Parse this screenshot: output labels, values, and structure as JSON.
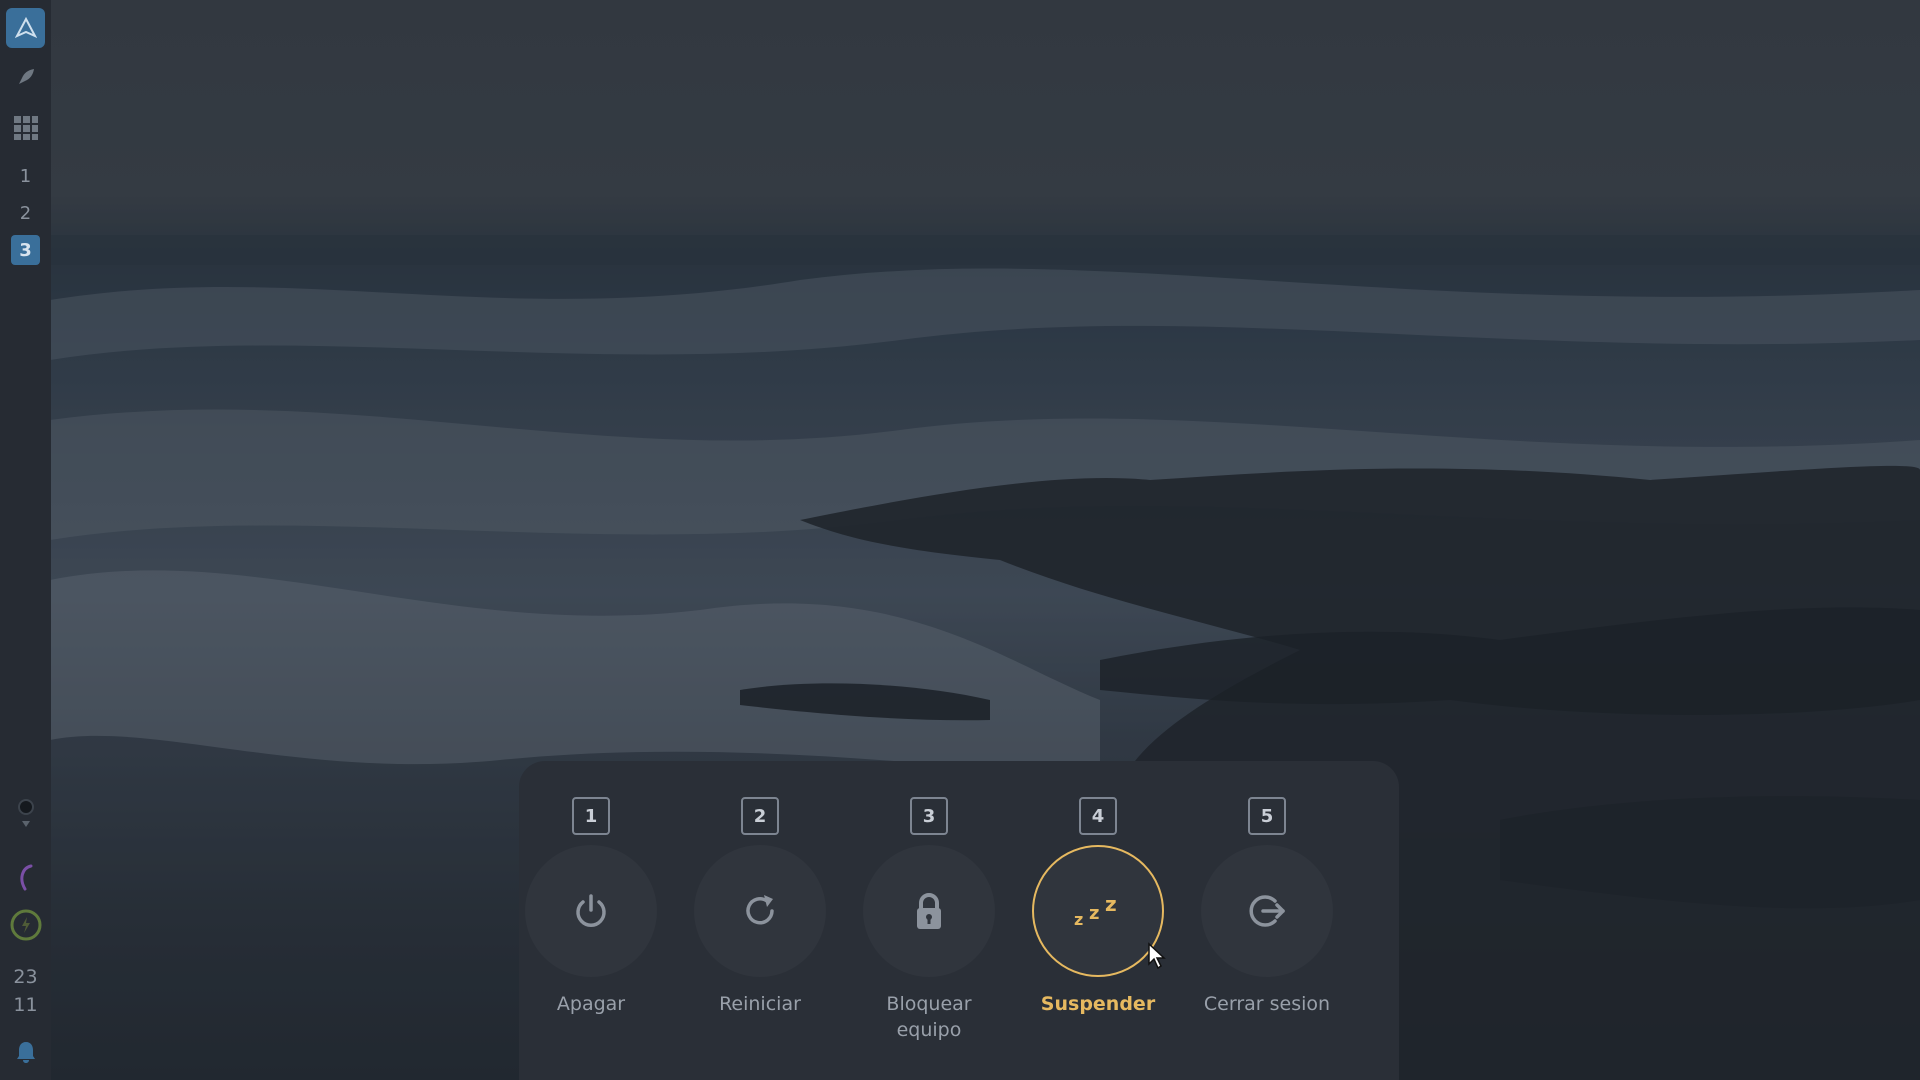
{
  "sidebar": {
    "logo_icon": "arch-logo-icon",
    "launcher_icon": "rocket-icon",
    "apps_icon": "grid-icon",
    "workspaces": [
      "1",
      "2",
      "3"
    ],
    "active_workspace": "3",
    "tray_icons": [
      "bluetooth-icon",
      "wifi-icon",
      "night-light-icon",
      "power-profile-icon"
    ],
    "clock": {
      "hours": "23",
      "minutes": "11"
    },
    "notification_icon": "bell-icon"
  },
  "power_menu": {
    "accent_color": "#e6b960",
    "selected": "Suspender",
    "options": [
      {
        "key": "1",
        "label": "Apagar",
        "icon": "power-icon"
      },
      {
        "key": "2",
        "label": "Reiniciar",
        "icon": "restart-icon"
      },
      {
        "key": "3",
        "label": "Bloquear equipo",
        "icon": "lock-icon"
      },
      {
        "key": "4",
        "label": "Suspender",
        "icon": "sleep-icon"
      },
      {
        "key": "5",
        "label": "Cerrar sesion",
        "icon": "logout-icon"
      }
    ]
  }
}
